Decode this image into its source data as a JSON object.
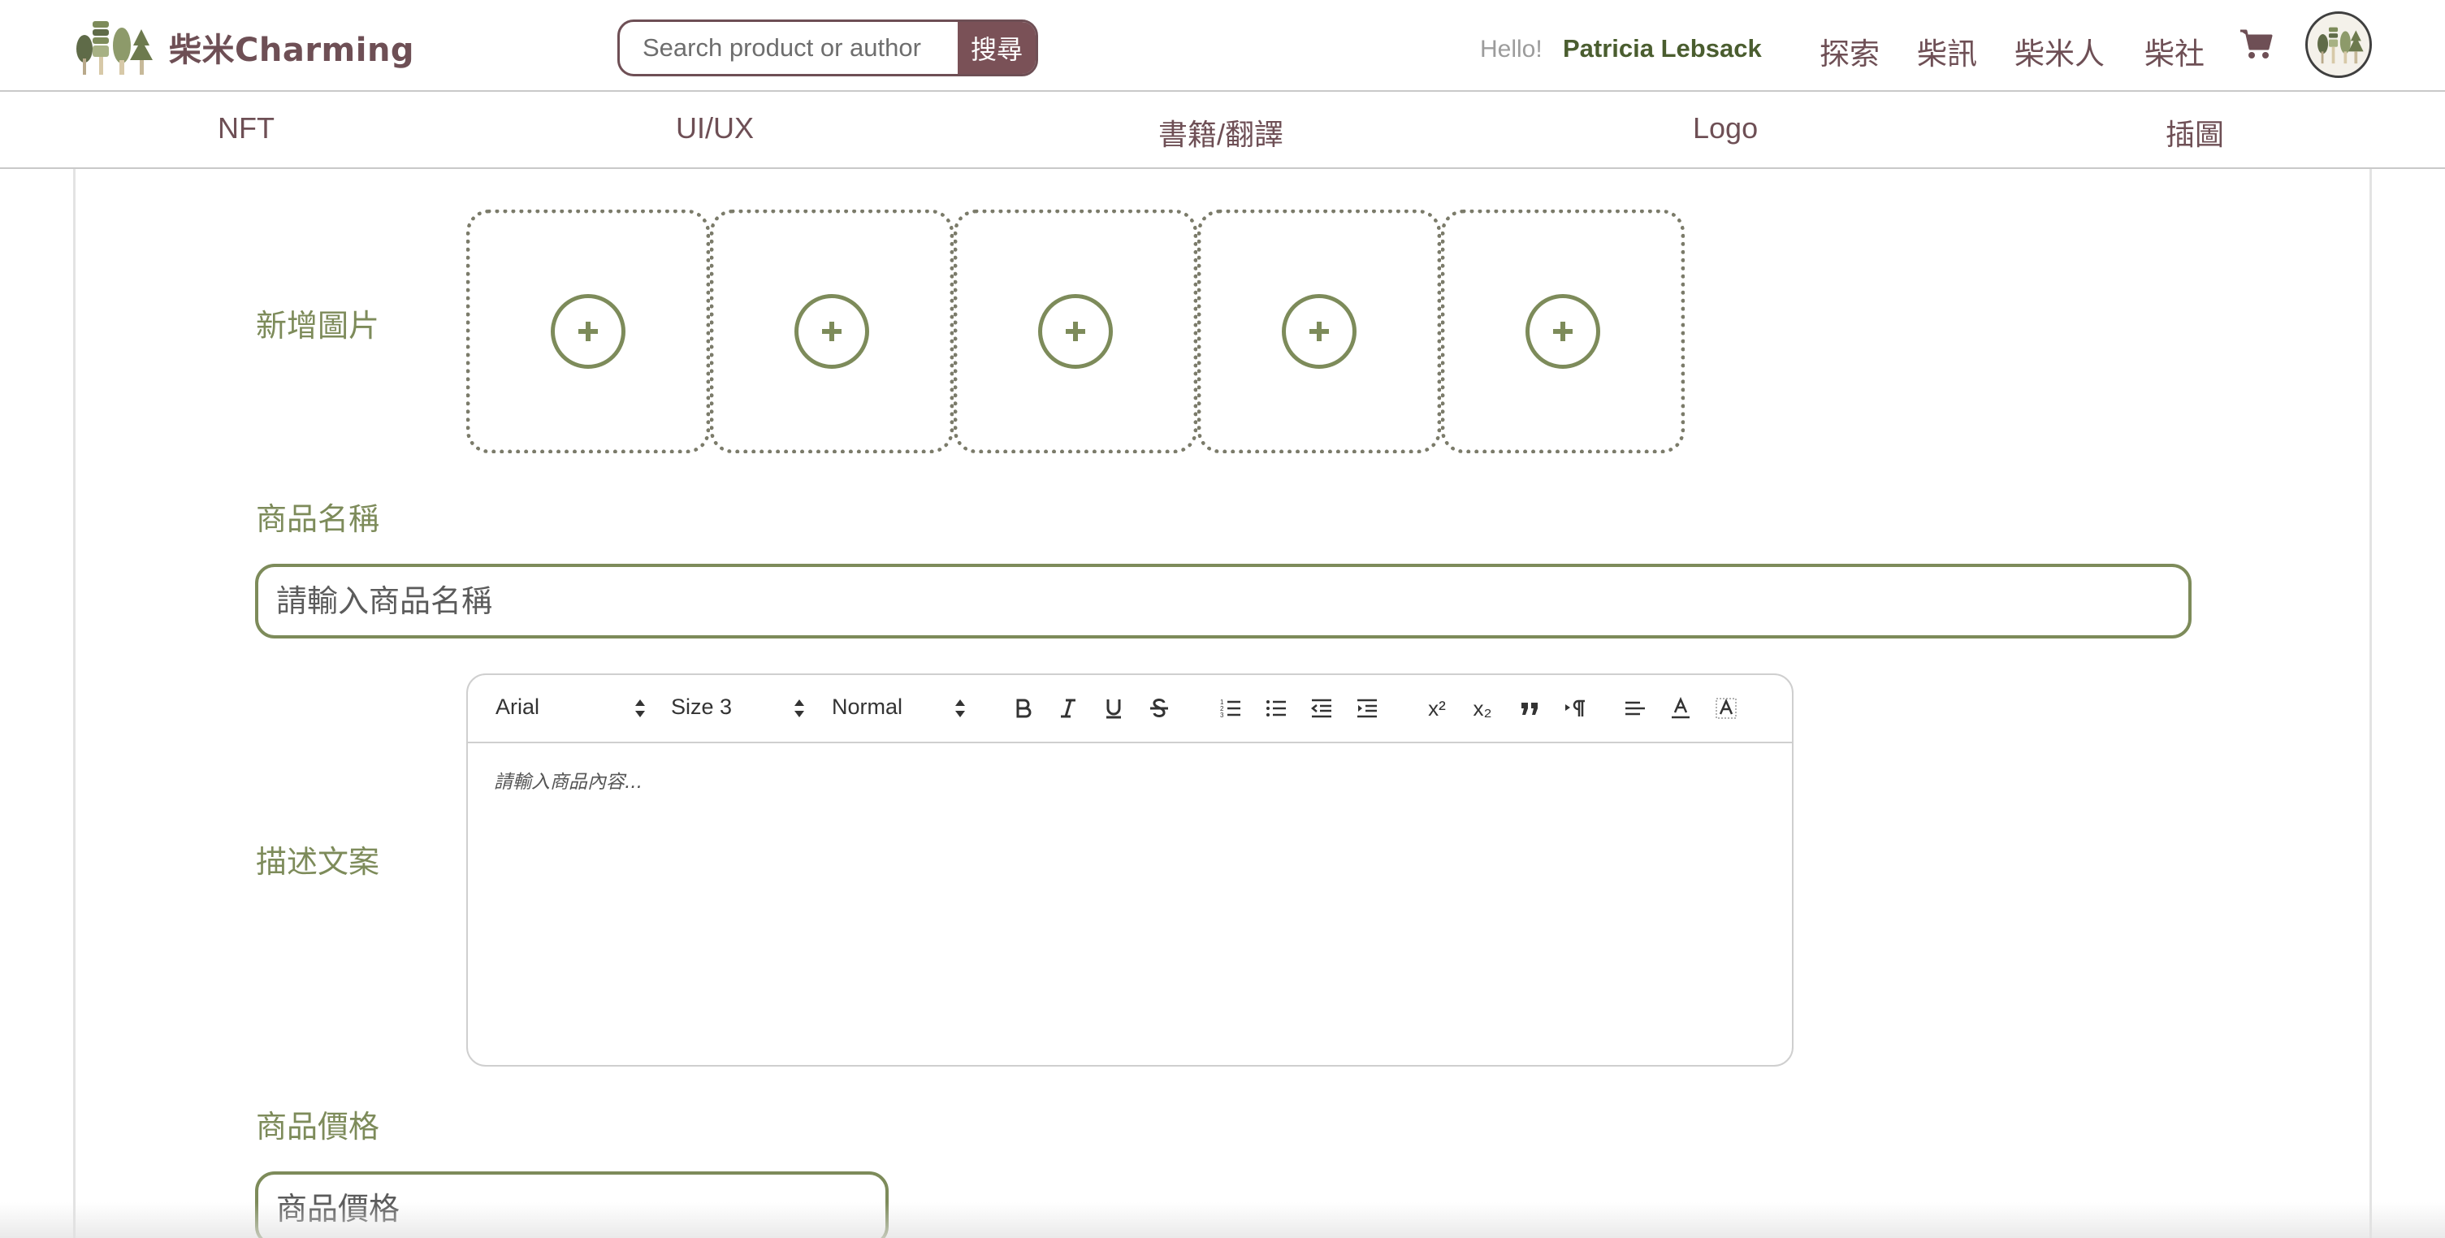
{
  "brand": {
    "name": "柴米Charming",
    "logo_icon": "tree-forest-icon"
  },
  "search": {
    "placeholder": "Search product or author",
    "button_label": "搜尋"
  },
  "user": {
    "greeting": "Hello!",
    "name": "Patricia Lebsack"
  },
  "nav": {
    "items": [
      "探索",
      "柴訊",
      "柴米人",
      "柴社"
    ],
    "cart_icon": "cart-icon",
    "avatar_icon": "avatar"
  },
  "categories": [
    "NFT",
    "UI/UX",
    "書籍/翻譯",
    "Logo",
    "插圖"
  ],
  "form": {
    "add_images_label": "新增圖片",
    "image_slots": 5,
    "product_name_label": "商品名稱",
    "product_name_placeholder": "請輸入商品名稱",
    "description_label": "描述文案",
    "description_placeholder": "請輸入商品內容...",
    "price_label": "商品價格",
    "price_placeholder": "商品價格"
  },
  "editor_toolbar": {
    "font": "Arial",
    "size": "Size 3",
    "style": "Normal",
    "buttons": [
      "bold",
      "italic",
      "underline",
      "strike",
      "ordered-list",
      "bullet-list",
      "outdent",
      "indent",
      "superscript",
      "subscript",
      "blockquote",
      "rtl",
      "align",
      "text-color",
      "background-color"
    ],
    "superscript_label": "x²",
    "subscript_label": "x₂"
  },
  "colors": {
    "brand": "#6e4f55",
    "accent": "#7d8b5a",
    "search_button": "#7a5157",
    "username": "#4a5d2f"
  }
}
